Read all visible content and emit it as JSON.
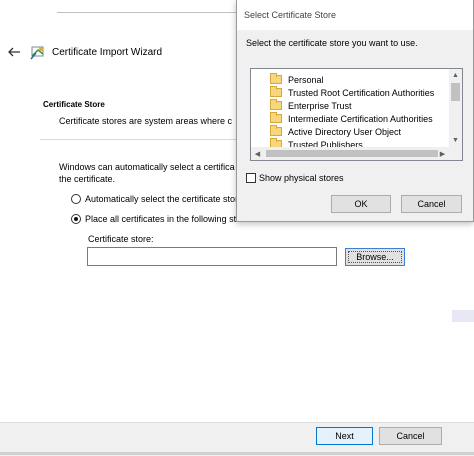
{
  "wizard": {
    "title": "Certificate Import Wizard",
    "section_title": "Certificate Store",
    "section_desc": "Certificate stores are system areas where c",
    "intro_line1": "Windows can automatically select a certifica",
    "intro_line2": "the certificate.",
    "radio_auto_label": "Automatically select the certificate store",
    "radio_place_label": "Place all certificates in the following st",
    "store_label": "Certificate store:",
    "store_value": "",
    "browse_label": "Browse...",
    "next_label": "Next",
    "cancel_label": "Cancel"
  },
  "dialog": {
    "title": "Select Certificate Store",
    "instruction": "Select the certificate store you want to use.",
    "stores": [
      "Personal",
      "Trusted Root Certification Authorities",
      "Enterprise Trust",
      "Intermediate Certification Authorities",
      "Active Directory User Object",
      "Trusted Publishers"
    ],
    "show_physical_label": "Show physical stores",
    "ok_label": "OK",
    "cancel_label": "Cancel"
  },
  "icons": {
    "back": "back-arrow-icon",
    "wizard": "certificate-wizard-icon",
    "folder": "folder-icon"
  },
  "colors": {
    "focus_border": "#0078d7",
    "folder": "#f7d67c"
  }
}
